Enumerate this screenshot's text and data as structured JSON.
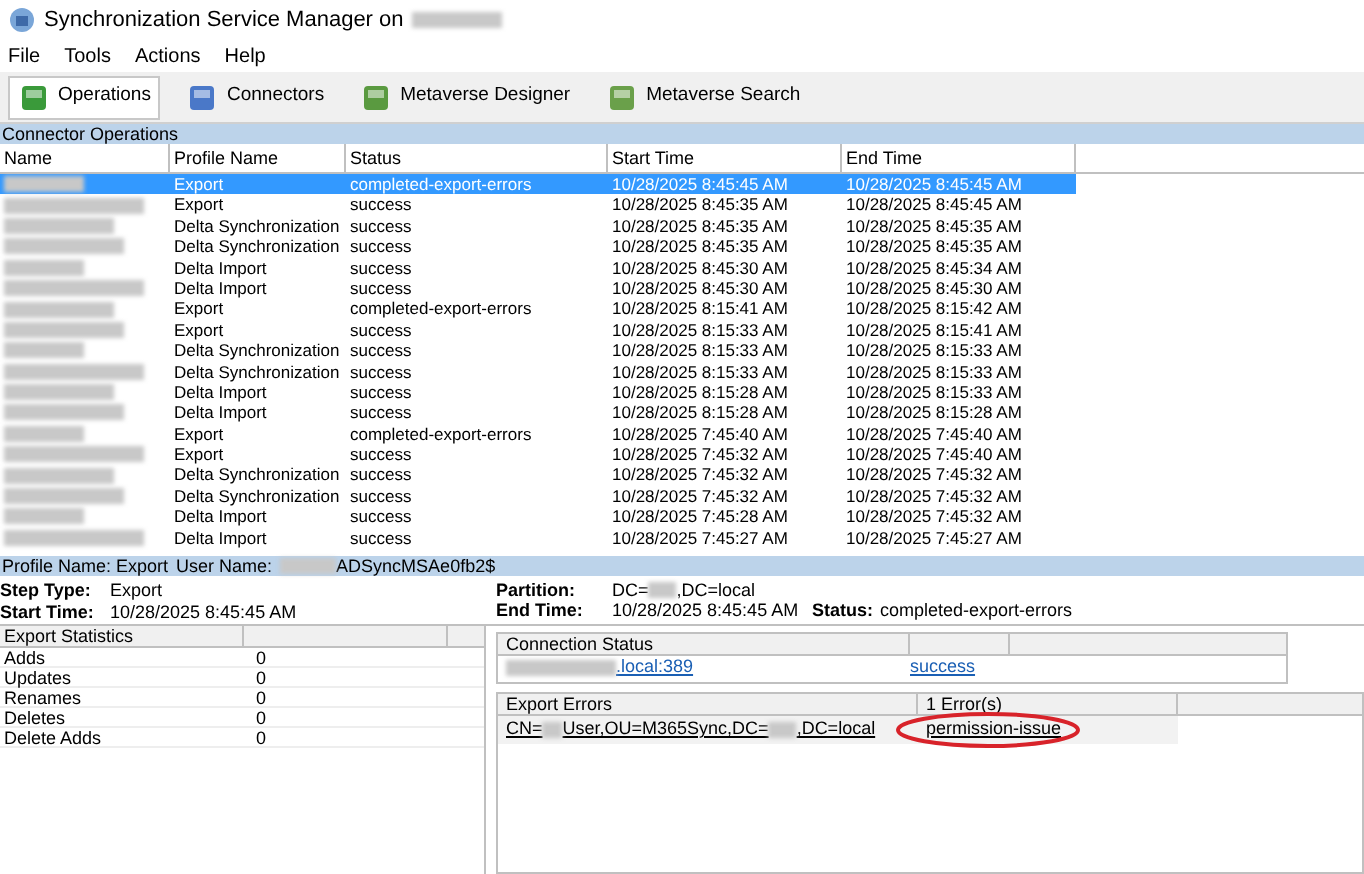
{
  "window": {
    "title": "Synchronization Service Manager on"
  },
  "menu": [
    "File",
    "Tools",
    "Actions",
    "Help"
  ],
  "toolbar": [
    {
      "label": "Operations",
      "selected": true
    },
    {
      "label": "Connectors",
      "selected": false
    },
    {
      "label": "Metaverse Designer",
      "selected": false
    },
    {
      "label": "Metaverse Search",
      "selected": false
    }
  ],
  "section_title": "Connector Operations",
  "table": {
    "columns": [
      "Name",
      "Profile Name",
      "Status",
      "Start Time",
      "End Time"
    ],
    "rows": [
      {
        "profile": "Export",
        "status": "completed-export-errors",
        "start": "10/28/2025 8:45:45 AM",
        "end": "10/28/2025 8:45:45 AM",
        "selected": true
      },
      {
        "profile": "Export",
        "status": "success",
        "start": "10/28/2025 8:45:35 AM",
        "end": "10/28/2025 8:45:45 AM",
        "selected": false
      },
      {
        "profile": "Delta Synchronization",
        "status": "success",
        "start": "10/28/2025 8:45:35 AM",
        "end": "10/28/2025 8:45:35 AM",
        "selected": false
      },
      {
        "profile": "Delta Synchronization",
        "status": "success",
        "start": "10/28/2025 8:45:35 AM",
        "end": "10/28/2025 8:45:35 AM",
        "selected": false
      },
      {
        "profile": "Delta Import",
        "status": "success",
        "start": "10/28/2025 8:45:30 AM",
        "end": "10/28/2025 8:45:34 AM",
        "selected": false
      },
      {
        "profile": "Delta Import",
        "status": "success",
        "start": "10/28/2025 8:45:30 AM",
        "end": "10/28/2025 8:45:30 AM",
        "selected": false
      },
      {
        "profile": "Export",
        "status": "completed-export-errors",
        "start": "10/28/2025 8:15:41 AM",
        "end": "10/28/2025 8:15:42 AM",
        "selected": false
      },
      {
        "profile": "Export",
        "status": "success",
        "start": "10/28/2025 8:15:33 AM",
        "end": "10/28/2025 8:15:41 AM",
        "selected": false
      },
      {
        "profile": "Delta Synchronization",
        "status": "success",
        "start": "10/28/2025 8:15:33 AM",
        "end": "10/28/2025 8:15:33 AM",
        "selected": false
      },
      {
        "profile": "Delta Synchronization",
        "status": "success",
        "start": "10/28/2025 8:15:33 AM",
        "end": "10/28/2025 8:15:33 AM",
        "selected": false
      },
      {
        "profile": "Delta Import",
        "status": "success",
        "start": "10/28/2025 8:15:28 AM",
        "end": "10/28/2025 8:15:33 AM",
        "selected": false
      },
      {
        "profile": "Delta Import",
        "status": "success",
        "start": "10/28/2025 8:15:28 AM",
        "end": "10/28/2025 8:15:28 AM",
        "selected": false
      },
      {
        "profile": "Export",
        "status": "completed-export-errors",
        "start": "10/28/2025 7:45:40 AM",
        "end": "10/28/2025 7:45:40 AM",
        "selected": false
      },
      {
        "profile": "Export",
        "status": "success",
        "start": "10/28/2025 7:45:32 AM",
        "end": "10/28/2025 7:45:40 AM",
        "selected": false
      },
      {
        "profile": "Delta Synchronization",
        "status": "success",
        "start": "10/28/2025 7:45:32 AM",
        "end": "10/28/2025 7:45:32 AM",
        "selected": false
      },
      {
        "profile": "Delta Synchronization",
        "status": "success",
        "start": "10/28/2025 7:45:32 AM",
        "end": "10/28/2025 7:45:32 AM",
        "selected": false
      },
      {
        "profile": "Delta Import",
        "status": "success",
        "start": "10/28/2025 7:45:28 AM",
        "end": "10/28/2025 7:45:32 AM",
        "selected": false
      },
      {
        "profile": "Delta Import",
        "status": "success",
        "start": "10/28/2025 7:45:27 AM",
        "end": "10/28/2025 7:45:27 AM",
        "selected": false
      }
    ]
  },
  "profile_bar": {
    "profile": "Profile Name: Export",
    "user_label": "User Name:",
    "user_suffix": "ADSyncMSAe0fb2$"
  },
  "details": {
    "step_type_label": "Step Type:",
    "step_type": "Export",
    "start_label": "Start Time:",
    "start": "10/28/2025 8:45:45 AM",
    "partition_label": "Partition:",
    "partition": [
      "DC=",
      ",DC=local"
    ],
    "end_label": "End Time:",
    "end": "10/28/2025 8:45:45 AM",
    "status_label": "Status:",
    "status": "completed-export-errors"
  },
  "export_statistics": {
    "title": "Export Statistics",
    "rows": [
      {
        "label": "Adds",
        "value": "0"
      },
      {
        "label": "Updates",
        "value": "0"
      },
      {
        "label": "Renames",
        "value": "0"
      },
      {
        "label": "Deletes",
        "value": "0"
      },
      {
        "label": "Delete Adds",
        "value": "0"
      }
    ]
  },
  "connection_status": {
    "title": "Connection Status",
    "server_suffix": ".local:389",
    "result": "success"
  },
  "export_errors": {
    "title": "Export Errors",
    "count": "1 Error(s)",
    "dn": [
      "CN=",
      "User,OU=M365Sync,DC=",
      ",DC=local"
    ],
    "error": "permission-issue"
  }
}
